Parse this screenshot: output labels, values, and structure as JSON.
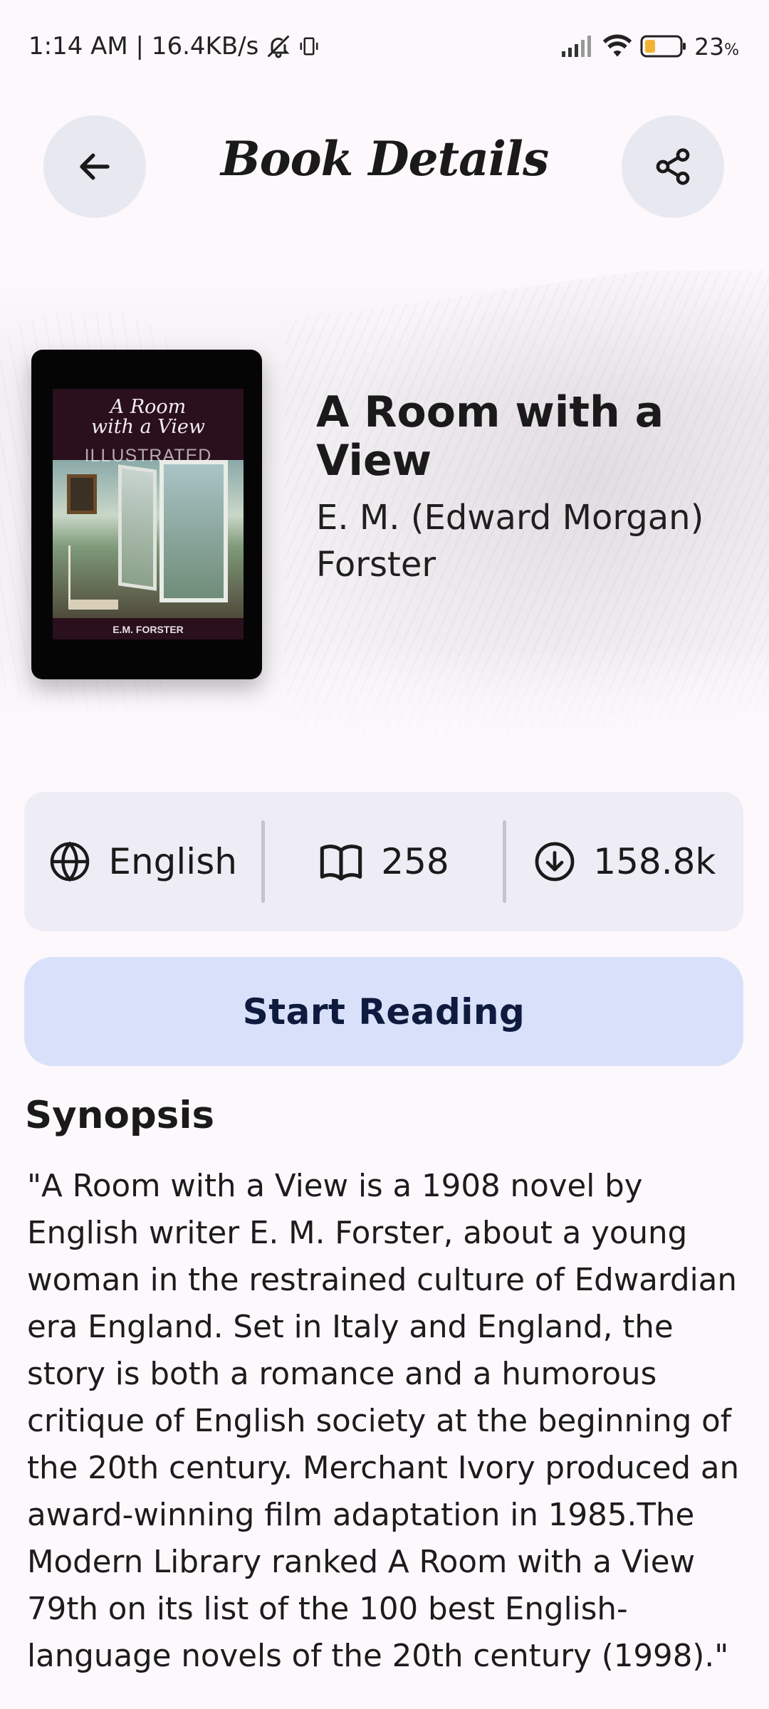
{
  "status_bar": {
    "time_speed": "1:14 AM | 16.4KB/s",
    "battery": "23",
    "battery_unit": "%",
    "icons": [
      "mute-bell-icon",
      "vibrate-icon",
      "signal-icon",
      "wifi-icon",
      "battery-icon"
    ]
  },
  "app_bar": {
    "title": "Book Details",
    "back_icon": "arrow-left-icon",
    "share_icon": "share-icon"
  },
  "book": {
    "title": "A Room with a View",
    "author": "E. M. (Edward Morgan) Forster",
    "cover": {
      "title_line1": "A Room",
      "title_line2": "with a View",
      "subtitle": "ILLUSTRATED",
      "author": "E.M. FORSTER"
    }
  },
  "stats": {
    "language": "English",
    "pages": "258",
    "downloads": "158.8k",
    "icons": [
      "globe-icon",
      "open-book-icon",
      "download-circle-icon"
    ]
  },
  "actions": {
    "start_reading": "Start Reading"
  },
  "synopsis": {
    "heading": "Synopsis",
    "text": "\"A Room with a View is a 1908 novel by English writer E. M. Forster, about a young woman in the restrained culture of Edwardian era England. Set in Italy and England, the story is both a romance and a humorous critique of English society at the beginning of the 20th century. Merchant Ivory produced an award-winning film adaptation in 1985.The Modern Library ranked A Room with a View 79th on its list of the 100 best English-language novels of the 20th century (1998).\""
  },
  "colors": {
    "background": "#fcf8fc",
    "stats_card": "#eeedf6",
    "primary_button": "#d9e1fa",
    "primary_button_text": "#0f1b3e",
    "icon_button": "#e8e8f0",
    "battery_fill": "#f2b233"
  }
}
